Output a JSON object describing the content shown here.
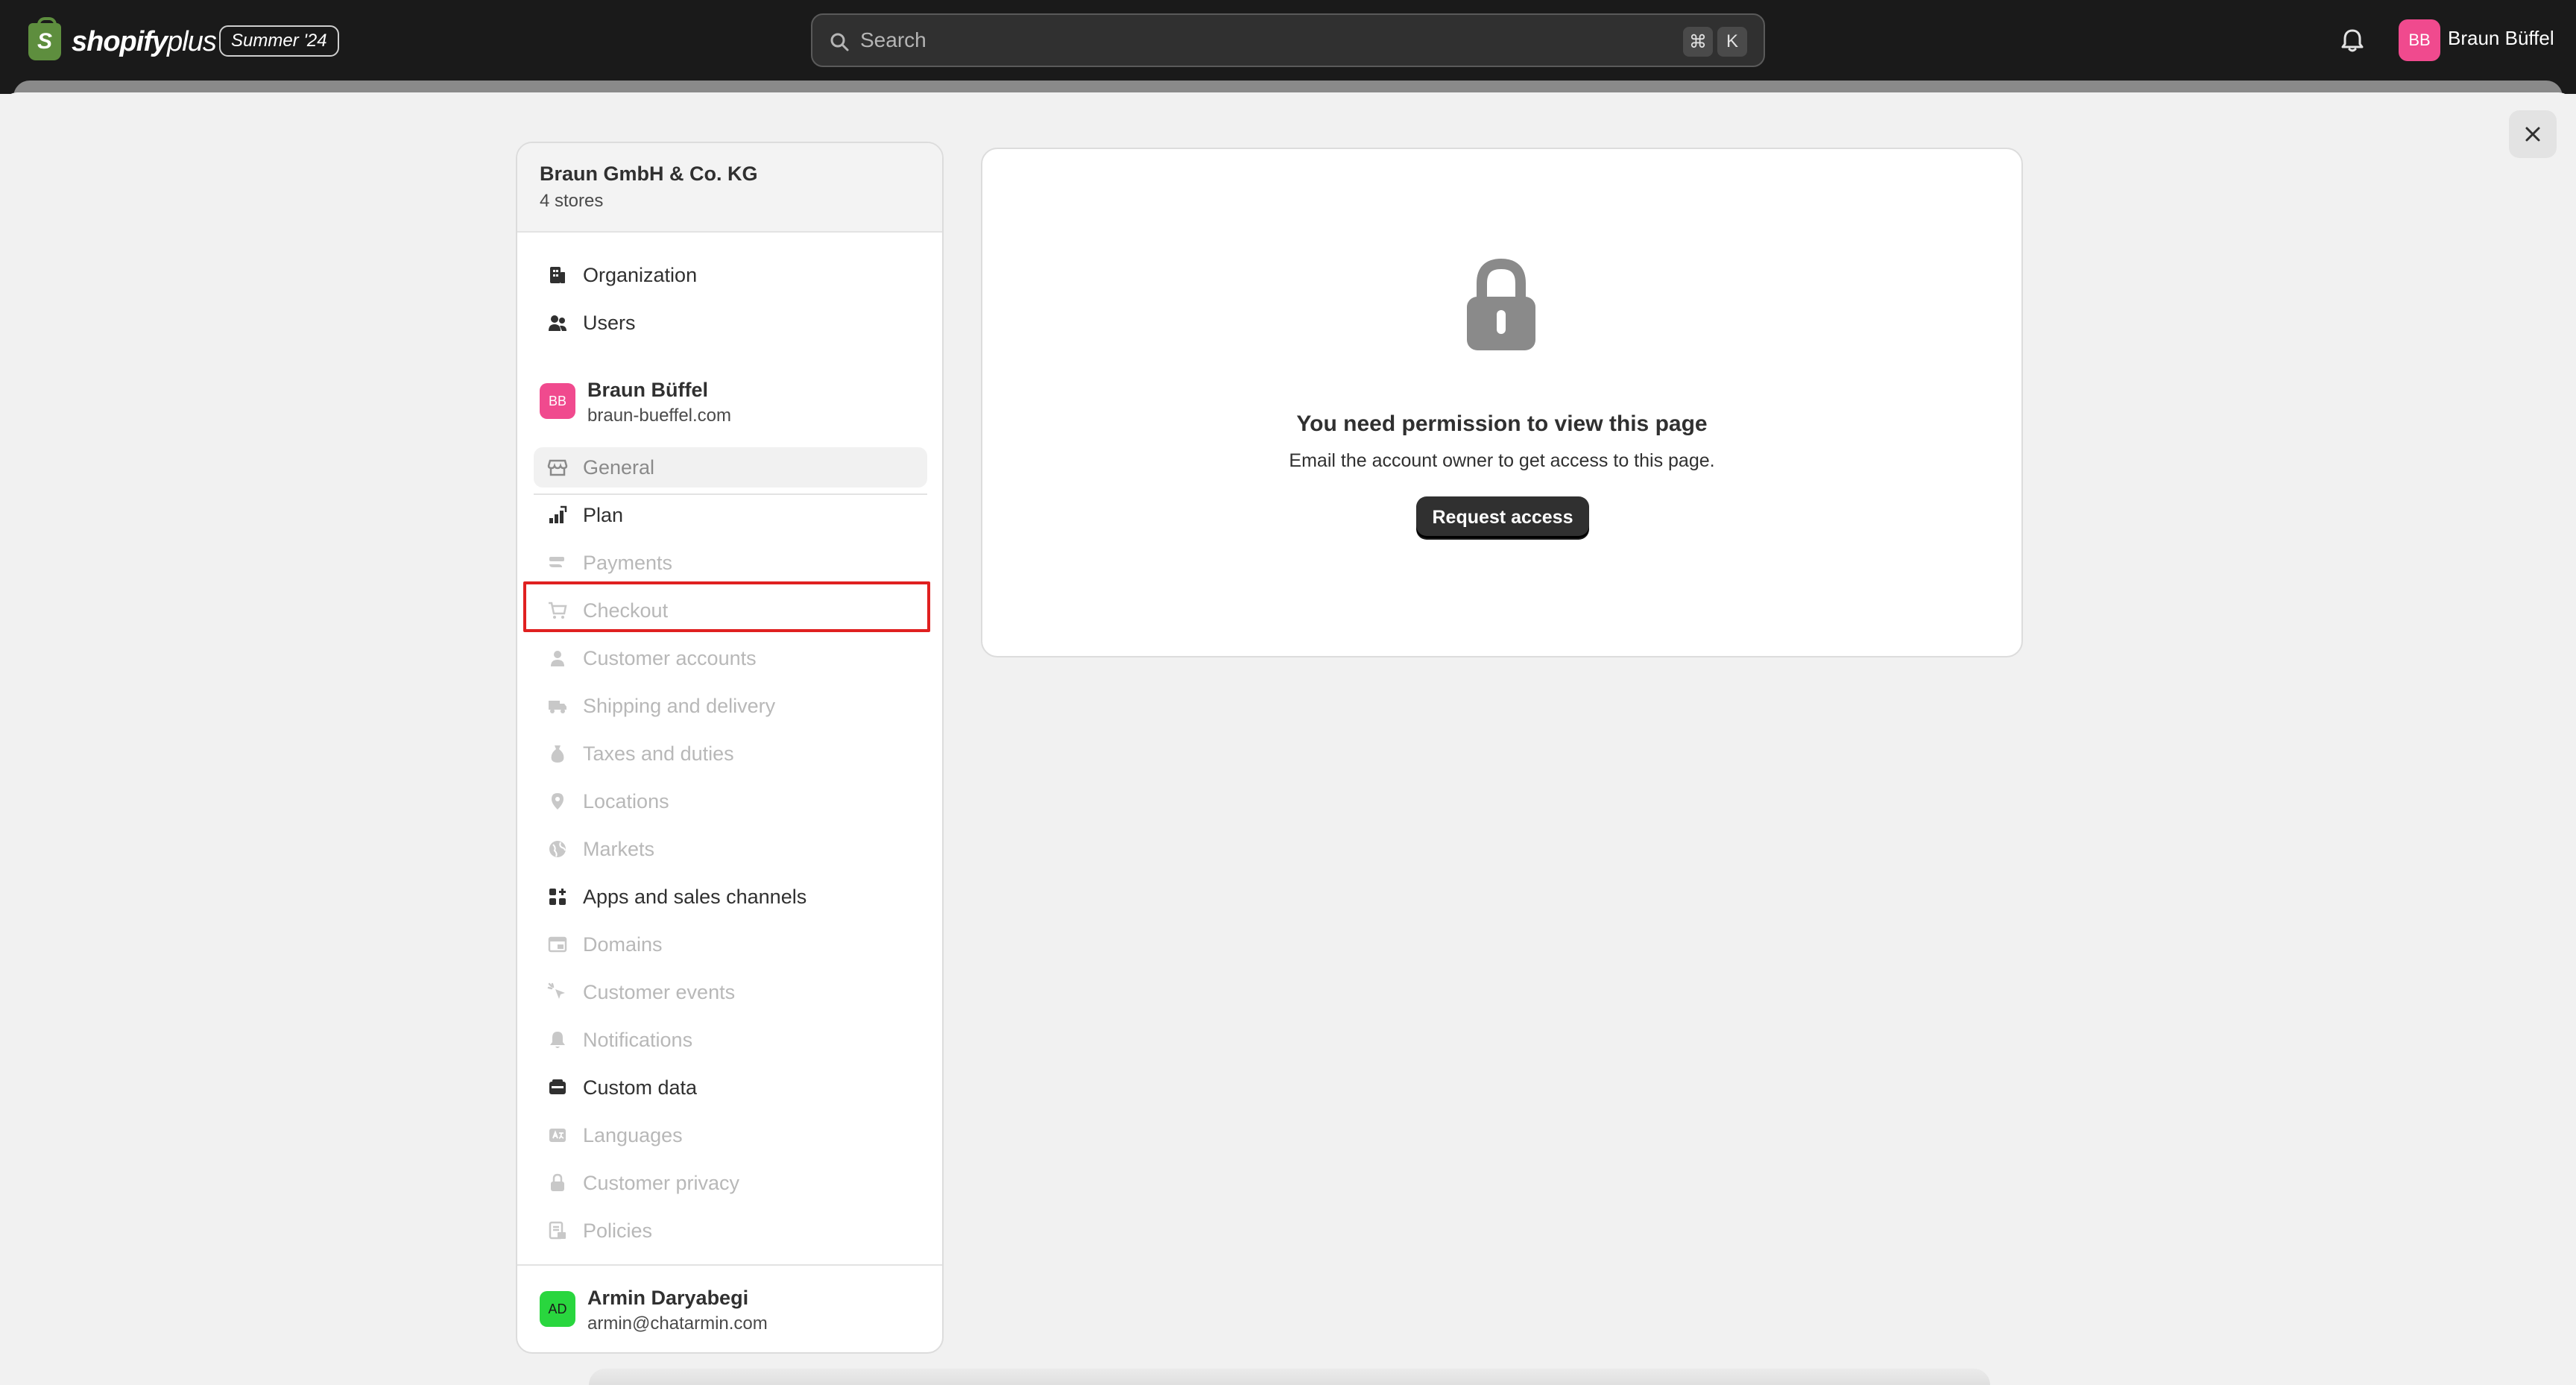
{
  "topbar": {
    "logo_text": "shopify",
    "logo_plus": "plus",
    "edition": "Summer '24",
    "search_placeholder": "Search",
    "shortcut_keys": [
      "⌘",
      "K"
    ],
    "user_initials": "BB",
    "user_name": "Braun Büffel"
  },
  "colors": {
    "topbar_bg": "#1a1a1a",
    "store_avatar": "#f04a8e",
    "user_avatar": "#29d63e",
    "highlight": "#e02020",
    "primary_button": "#303030"
  },
  "sidebar": {
    "org_name": "Braun GmbH & Co. KG",
    "org_stores": "4 stores",
    "org_items": [
      {
        "label": "Organization",
        "icon": "building-icon"
      },
      {
        "label": "Users",
        "icon": "users-icon"
      }
    ],
    "store": {
      "initials": "BB",
      "name": "Braun Büffel",
      "domain": "braun-bueffel.com"
    },
    "store_items": [
      {
        "label": "General",
        "icon": "store-icon",
        "state": "selected"
      },
      {
        "label": "Plan",
        "icon": "chart-icon",
        "state": "active"
      },
      {
        "label": "Payments",
        "icon": "payments-icon",
        "state": "disabled"
      },
      {
        "label": "Checkout",
        "icon": "cart-icon",
        "state": "disabled"
      },
      {
        "label": "Customer accounts",
        "icon": "person-icon",
        "state": "disabled"
      },
      {
        "label": "Shipping and delivery",
        "icon": "truck-icon",
        "state": "disabled"
      },
      {
        "label": "Taxes and duties",
        "icon": "money-bag-icon",
        "state": "disabled"
      },
      {
        "label": "Locations",
        "icon": "location-pin-icon",
        "state": "disabled"
      },
      {
        "label": "Markets",
        "icon": "globe-icon",
        "state": "disabled"
      },
      {
        "label": "Apps and sales channels",
        "icon": "apps-icon",
        "state": "active"
      },
      {
        "label": "Domains",
        "icon": "domain-icon",
        "state": "disabled"
      },
      {
        "label": "Customer events",
        "icon": "cursor-click-icon",
        "state": "disabled"
      },
      {
        "label": "Notifications",
        "icon": "bell-icon",
        "state": "disabled"
      },
      {
        "label": "Custom data",
        "icon": "database-icon",
        "state": "active"
      },
      {
        "label": "Languages",
        "icon": "language-icon",
        "state": "disabled"
      },
      {
        "label": "Customer privacy",
        "icon": "lock-icon",
        "state": "disabled"
      },
      {
        "label": "Policies",
        "icon": "policy-icon",
        "state": "disabled"
      }
    ],
    "user": {
      "initials": "AD",
      "name": "Armin Daryabegi",
      "email": "armin@chatarmin.com"
    }
  },
  "content": {
    "title": "You need permission to view this page",
    "description": "Email the account owner to get access to this page.",
    "button_label": "Request access"
  }
}
